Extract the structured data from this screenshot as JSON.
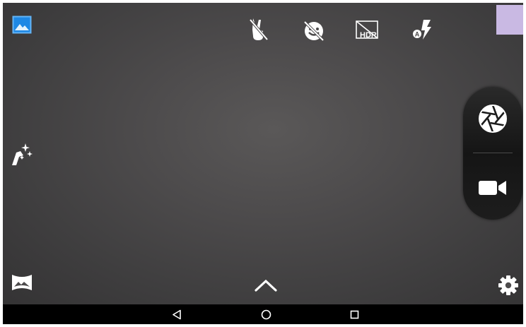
{
  "top_bar": {
    "gallery_icon": "gallery-icon",
    "gesture_icon": "gesture-shot-off-icon",
    "smile_icon": "smile-shot-off-icon",
    "hdr": {
      "icon": "hdr-off-icon",
      "label": "HDR"
    },
    "flash": {
      "icon": "flash-auto-icon",
      "mode_label": "A"
    },
    "thumbnail_color": "#c9b9e3"
  },
  "left_bar": {
    "beauty_icon": "beauty-mode-icon",
    "panorama_icon": "panorama-icon"
  },
  "right_panel": {
    "shutter_icon": "camera-shutter-icon",
    "video_icon": "video-camera-icon",
    "settings_icon": "settings-gear-icon"
  },
  "bottom": {
    "expand_icon": "chevron-up-icon"
  },
  "navbar": {
    "back_icon": "back-icon",
    "home_icon": "home-icon",
    "recents_icon": "recents-icon"
  },
  "colors": {
    "accent": "#2196f3",
    "icon": "#ffffff",
    "viewfinder": "#4d4b4c"
  }
}
